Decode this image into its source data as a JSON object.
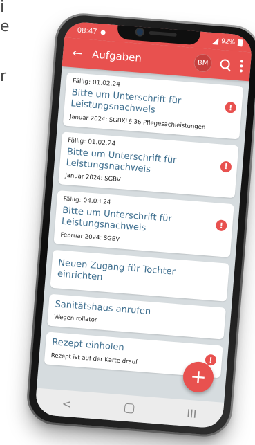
{
  "background_text": {
    "line1": "i",
    "line2": "e",
    "line3": "r"
  },
  "status_bar": {
    "time": "08:47",
    "battery": "92%"
  },
  "app_bar": {
    "back_glyph": "←",
    "title": "Aufgaben",
    "avatar_initials": "BM"
  },
  "tasks": [
    {
      "due": "Fällig: 01.02.24",
      "title": "Bitte um Unterschrift für Leistungsnachweis",
      "subtitle": "Januar 2024: SGBXI § 36 Pflegesachleistungen",
      "alert": "!"
    },
    {
      "due": "Fällig: 01.02.24",
      "title": "Bitte um Unterschrift für Leistungsnachweis",
      "subtitle": "Januar 2024: SGBV",
      "alert": "!"
    },
    {
      "due": "Fällig: 04.03.24",
      "title": "Bitte um Unterschrift für Leistungsnachweis",
      "subtitle": "Februar 2024: SGBV",
      "alert": "!"
    },
    {
      "title": "Neuen Zugang für Tochter einrichten"
    },
    {
      "title": "Sanitätshaus anrufen",
      "subtitle": "Wegen rollator"
    },
    {
      "title": "Rezept einholen",
      "subtitle": "Rezept ist auf der Karte drauf",
      "alert": "!"
    }
  ],
  "fab": {
    "label": "+"
  },
  "nav_bar": {
    "back": "<",
    "recents": "III"
  },
  "colors": {
    "accent": "#e8514f",
    "title_text": "#3f6f8f",
    "list_background": "#d6dcdf"
  },
  "icons": [
    "back-arrow-icon",
    "search-icon",
    "more-vert-icon",
    "alert-icon",
    "plus-icon"
  ]
}
